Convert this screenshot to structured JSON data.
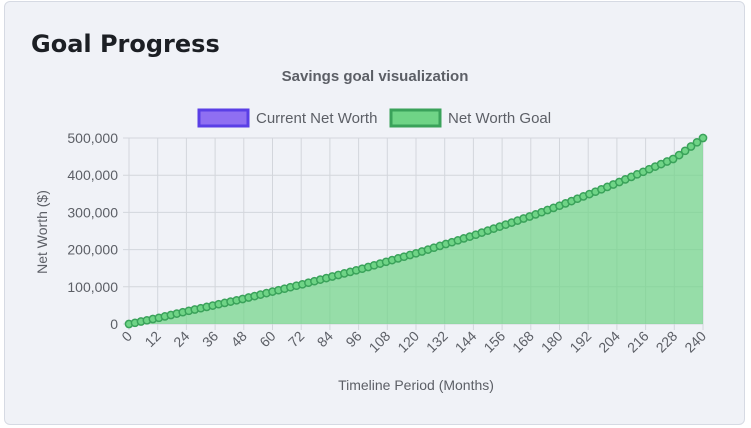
{
  "card": {
    "title": "Goal Progress"
  },
  "chart_data": {
    "type": "area",
    "title": "Savings goal visualization",
    "xlabel": "Timeline Period (Months)",
    "ylabel": "Net Worth ($)",
    "xlim": [
      0,
      240
    ],
    "ylim": [
      0,
      500000
    ],
    "x_ticks": [
      0,
      12,
      24,
      36,
      48,
      60,
      72,
      84,
      96,
      108,
      120,
      132,
      144,
      156,
      168,
      180,
      192,
      204,
      216,
      228,
      240
    ],
    "y_ticks": [
      0,
      100000,
      200000,
      300000,
      400000,
      500000
    ],
    "y_tick_labels": [
      "0",
      "100,000",
      "200,000",
      "300,000",
      "400,000",
      "500,000"
    ],
    "grid": true,
    "legend_position": "top",
    "series": [
      {
        "name": "Current Net Worth",
        "color": "#5a3fe6",
        "fill": "#8f6ff2",
        "x": [],
        "values": []
      },
      {
        "name": "Net Worth Goal",
        "color": "#3aa25a",
        "fill": "#6fd486",
        "x": [
          0,
          12,
          24,
          36,
          48,
          60,
          72,
          84,
          96,
          108,
          120,
          132,
          144,
          156,
          168,
          180,
          192,
          204,
          216,
          228,
          240
        ],
        "values": [
          0,
          16000,
          34000,
          51000,
          68000,
          87000,
          106000,
          126000,
          146000,
          168000,
          190000,
          214000,
          238000,
          264000,
          290000,
          318000,
          348000,
          379000,
          412000,
          445000,
          500000
        ]
      }
    ]
  }
}
